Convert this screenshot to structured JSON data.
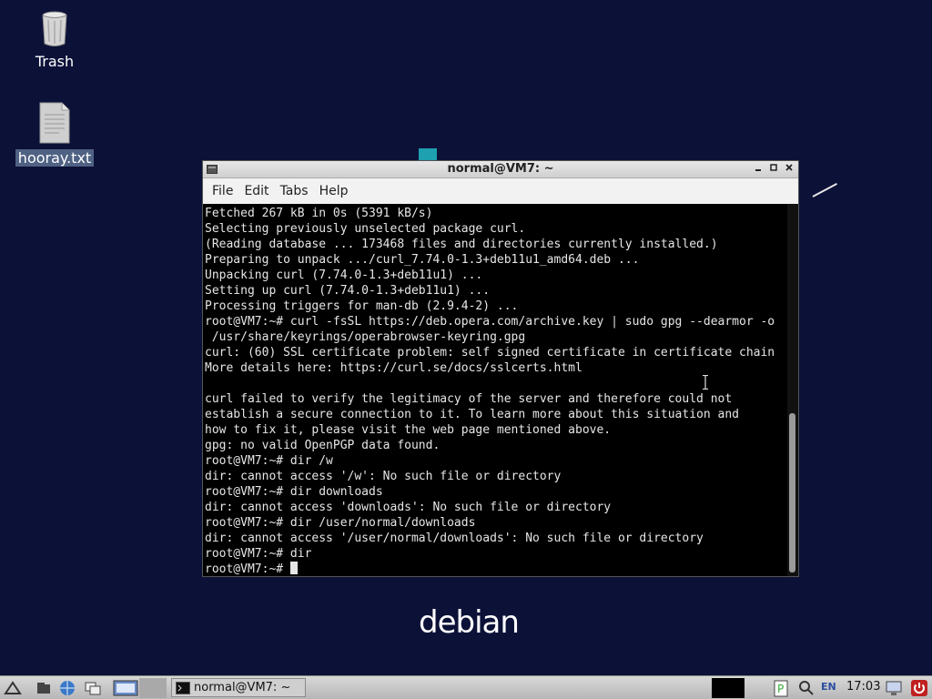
{
  "desktop": {
    "icons": [
      {
        "label": "Trash"
      },
      {
        "label": "hooray.txt"
      }
    ],
    "logo_text": "debian"
  },
  "window": {
    "title": "normal@VM7: ~",
    "menu": [
      "File",
      "Edit",
      "Tabs",
      "Help"
    ],
    "terminal_lines": [
      "Fetched 267 kB in 0s (5391 kB/s)",
      "Selecting previously unselected package curl.",
      "(Reading database ... 173468 files and directories currently installed.)",
      "Preparing to unpack .../curl_7.74.0-1.3+deb11u1_amd64.deb ...",
      "Unpacking curl (7.74.0-1.3+deb11u1) ...",
      "Setting up curl (7.74.0-1.3+deb11u1) ...",
      "Processing triggers for man-db (2.9.4-2) ...",
      "root@VM7:~# curl -fsSL https://deb.opera.com/archive.key | sudo gpg --dearmor -o",
      " /usr/share/keyrings/operabrowser-keyring.gpg",
      "curl: (60) SSL certificate problem: self signed certificate in certificate chain",
      "More details here: https://curl.se/docs/sslcerts.html",
      "",
      "curl failed to verify the legitimacy of the server and therefore could not",
      "establish a secure connection to it. To learn more about this situation and",
      "how to fix it, please visit the web page mentioned above.",
      "gpg: no valid OpenPGP data found.",
      "root@VM7:~# dir /w",
      "dir: cannot access '/w': No such file or directory",
      "root@VM7:~# dir downloads",
      "dir: cannot access 'downloads': No such file or directory",
      "root@VM7:~# dir /user/normal/downloads",
      "dir: cannot access '/user/normal/downloads': No such file or directory",
      "root@VM7:~# dir"
    ],
    "prompt": "root@VM7:~# "
  },
  "taskbar": {
    "task_label": "normal@VM7: ~",
    "lang": "EN",
    "clock": "17:03"
  }
}
